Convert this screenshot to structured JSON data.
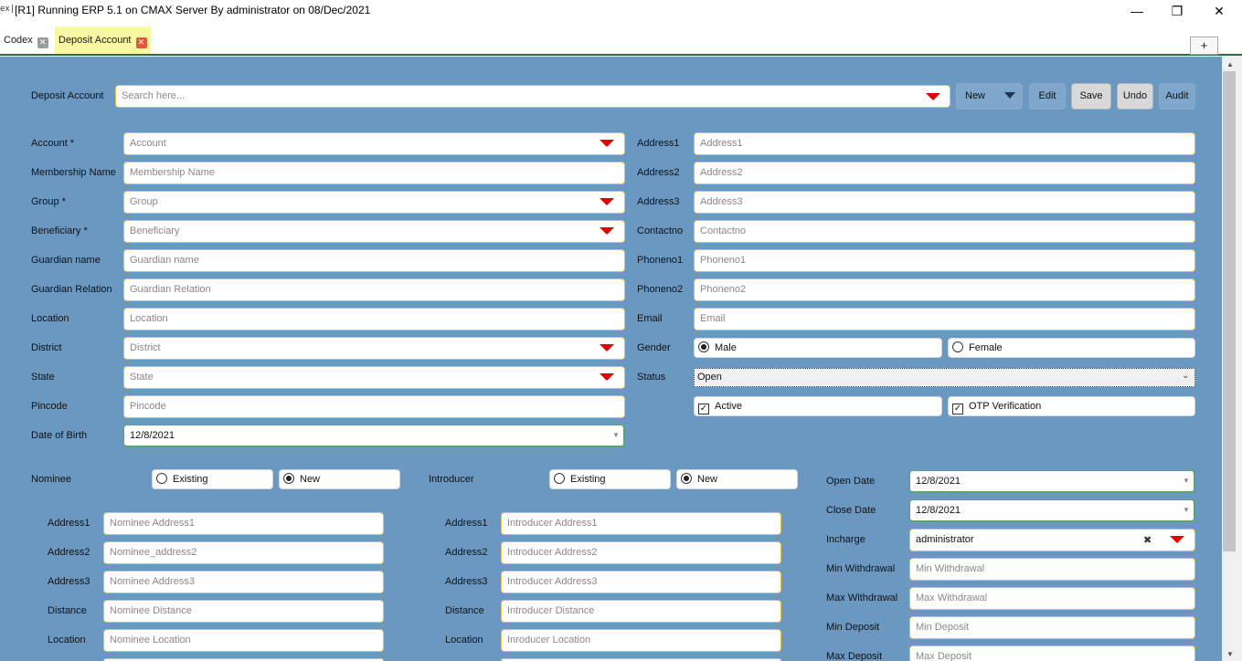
{
  "window": {
    "icon": "ex|",
    "title": "[R1] Running ERP 5.1 on CMAX Server By administrator on 08/Dec/2021",
    "minimize": "—",
    "maximize": "❐",
    "close": "✕"
  },
  "tabs": [
    {
      "label": "Codex",
      "close": "✕",
      "active": false
    },
    {
      "label": "Deposit Account",
      "close": "✕",
      "active": true
    }
  ],
  "tab_add": "+",
  "colors": {
    "accent": "#e00000",
    "tab_active": "#f7f7a4",
    "field_border": "#e3c14b",
    "background": "#6a98c1"
  },
  "toolbar": {
    "label": "Deposit Account",
    "search_placeholder": "Search here...",
    "new": "New",
    "edit": "Edit",
    "save": "Save",
    "undo": "Undo",
    "audit": "Audit"
  },
  "left_form": {
    "account": {
      "label": "Account *",
      "placeholder": "Account"
    },
    "membership_name": {
      "label": "Membership Name",
      "placeholder": "Membership Name"
    },
    "group": {
      "label": "Group *",
      "placeholder": "Group"
    },
    "beneficiary": {
      "label": "Beneficiary *",
      "placeholder": "Beneficiary"
    },
    "guardian_name": {
      "label": "Guardian name",
      "placeholder": "Guardian name"
    },
    "guardian_relation": {
      "label": "Guardian Relation",
      "placeholder": "Guardian Relation"
    },
    "location": {
      "label": "Location",
      "placeholder": "Location"
    },
    "district": {
      "label": "District",
      "placeholder": "District"
    },
    "state": {
      "label": "State",
      "placeholder": "State"
    },
    "pincode": {
      "label": "Pincode",
      "placeholder": "Pincode"
    },
    "dob": {
      "label": "Date of Birth",
      "value": "12/8/2021"
    }
  },
  "right_form": {
    "address1": {
      "label": "Address1",
      "placeholder": "Address1"
    },
    "address2": {
      "label": "Address2",
      "placeholder": "Address2"
    },
    "address3": {
      "label": "Address3",
      "placeholder": "Address3"
    },
    "contactno": {
      "label": "Contactno",
      "placeholder": "Contactno"
    },
    "phoneno1": {
      "label": "Phoneno1",
      "placeholder": "Phoneno1"
    },
    "phoneno2": {
      "label": "Phoneno2",
      "placeholder": "Phoneno2"
    },
    "email": {
      "label": "Email",
      "placeholder": "Email"
    },
    "gender": {
      "label": "Gender",
      "male": "Male",
      "female": "Female",
      "selected": "Male"
    },
    "status": {
      "label": "Status",
      "value": "Open"
    },
    "active": "Active",
    "otp": "OTP Verification"
  },
  "nominee": {
    "label": "Nominee",
    "existing": "Existing",
    "new": "New",
    "address1": {
      "label": "Address1",
      "placeholder": "Nominee Address1"
    },
    "address2": {
      "label": "Address2",
      "placeholder": "Nominee_address2"
    },
    "address3": {
      "label": "Address3",
      "placeholder": "Nominee  Address3"
    },
    "distance": {
      "label": "Distance",
      "placeholder": "Nominee Distance"
    },
    "location": {
      "label": "Location",
      "placeholder": "Nominee Location"
    }
  },
  "introducer": {
    "label": "Introducer",
    "existing": "Existing",
    "new": "New",
    "address1": {
      "label": "Address1",
      "placeholder": "Introducer  Address1"
    },
    "address2": {
      "label": "Address2",
      "placeholder": "Introducer  Address2"
    },
    "address3": {
      "label": "Address3",
      "placeholder": "Introducer  Address3"
    },
    "distance": {
      "label": "Distance",
      "placeholder": "Introducer Distance"
    },
    "location": {
      "label": "Location",
      "placeholder": "Inroducer Location"
    }
  },
  "account_details": {
    "open_date": {
      "label": "Open Date",
      "value": "12/8/2021"
    },
    "close_date": {
      "label": "Close Date",
      "value": "12/8/2021"
    },
    "incharge": {
      "label": "Incharge",
      "value": "administrator",
      "clear": "✖"
    },
    "min_withdrawal": {
      "label": "Min Withdrawal",
      "placeholder": "Min Withdrawal"
    },
    "max_withdrawal": {
      "label": "Max Withdrawal",
      "placeholder": "Max Withdrawal"
    },
    "min_deposit": {
      "label": "Min Deposit",
      "placeholder": "Min Deposit"
    },
    "max_deposit": {
      "label": "Max Deposit",
      "placeholder": "Max Deposit"
    }
  }
}
